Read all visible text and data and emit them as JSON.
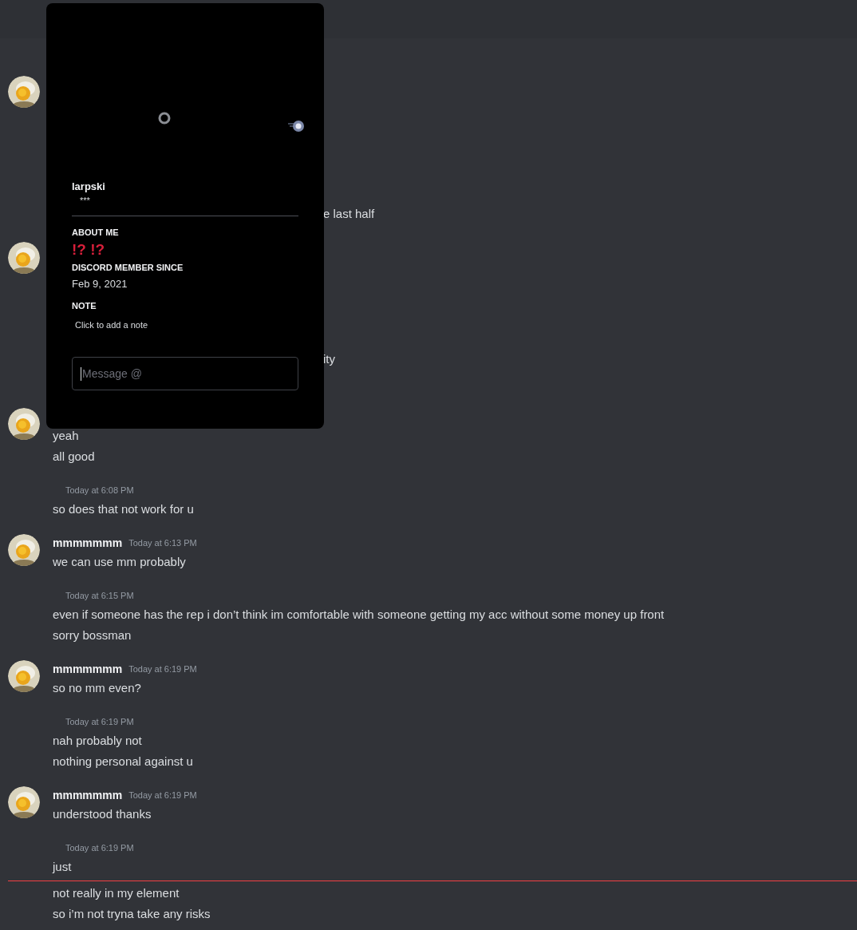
{
  "hidden_area": {
    "fragments": [
      "e last half",
      "ity"
    ]
  },
  "messages": [
    {
      "kind": "group",
      "lines": [
        "yeah",
        "all good"
      ]
    },
    {
      "kind": "continued",
      "time": "Today at 6:08 PM",
      "lines": [
        "so does that not work for u"
      ]
    },
    {
      "kind": "group",
      "name": "mmmmmmm",
      "time": "Today at 6:13 PM",
      "lines": [
        "we can use mm probably"
      ]
    },
    {
      "kind": "continued",
      "time": "Today at 6:15 PM",
      "lines": [
        "even if someone has the rep i don’t think im comfortable with someone getting my acc without some money up front",
        "sorry bossman"
      ]
    },
    {
      "kind": "group",
      "name": "mmmmmmm",
      "time": "Today at 6:19 PM",
      "lines": [
        "so no mm even?"
      ]
    },
    {
      "kind": "continued",
      "time": "Today at 6:19 PM",
      "lines": [
        "nah probably not",
        "nothing personal against u"
      ]
    },
    {
      "kind": "group",
      "name": "mmmmmmm",
      "time": "Today at 6:19 PM",
      "lines": [
        "understood thanks"
      ]
    },
    {
      "kind": "continued",
      "time": "Today at 6:19 PM",
      "lines": [
        "just"
      ]
    },
    {
      "kind": "divider"
    },
    {
      "kind": "lines",
      "lines": [
        "not really in my element",
        "so i’m not tryna take any risks"
      ]
    }
  ],
  "profile": {
    "name": "larpski",
    "tagline": "***",
    "about_heading": "ABOUT ME",
    "about": "!? !?",
    "since_heading": "DISCORD MEMBER SINCE",
    "since": "Feb 9, 2021",
    "note_heading": "NOTE",
    "note_placeholder": "Click to add a note",
    "message_placeholder": "Message @"
  }
}
